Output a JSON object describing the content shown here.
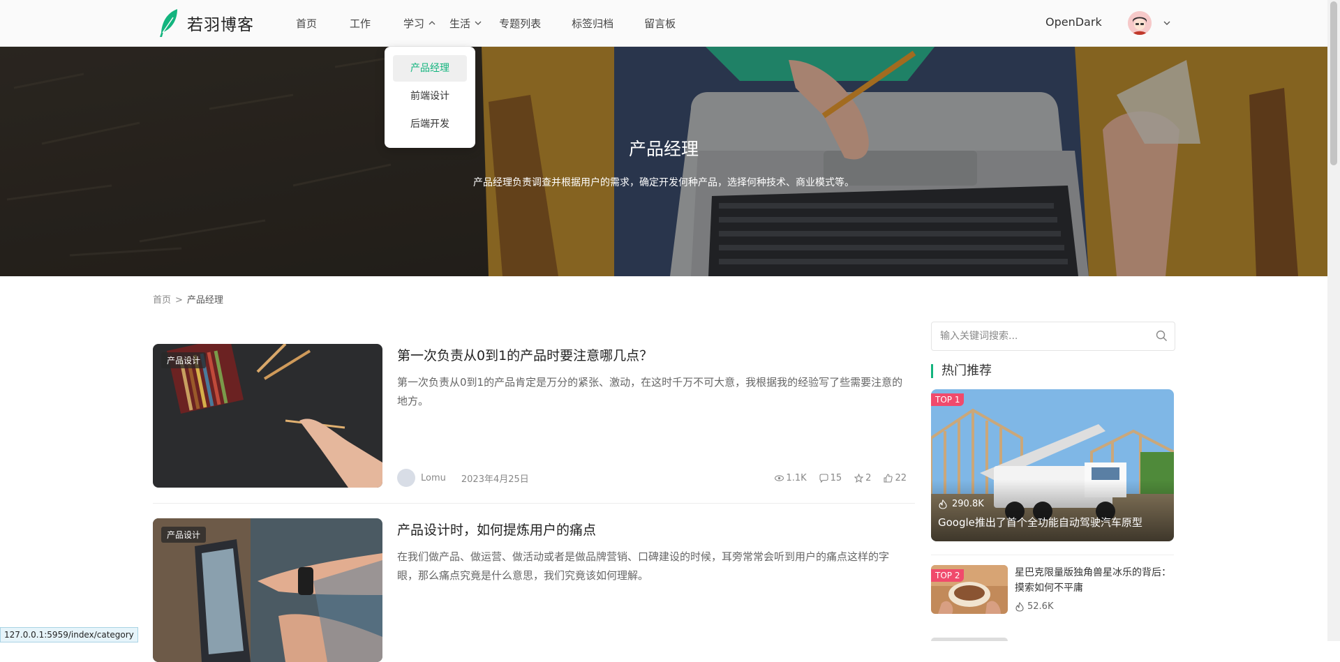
{
  "header": {
    "logo_text": "若羽博客",
    "nav": [
      {
        "label": "首页"
      },
      {
        "label": "工作"
      },
      {
        "label": "学习"
      },
      {
        "label": "生活"
      },
      {
        "label": "专题列表"
      },
      {
        "label": "标签归档"
      },
      {
        "label": "留言板"
      }
    ],
    "opendark_label": "OpenDark"
  },
  "dropdown": {
    "items": [
      {
        "label": "产品经理"
      },
      {
        "label": "前端设计"
      },
      {
        "label": "后端开发"
      }
    ]
  },
  "banner": {
    "title": "产品经理",
    "description": "产品经理负责调查并根据用户的需求，确定开发何种产品，选择何种技术、商业模式等。"
  },
  "breadcrumb": {
    "home": "首页",
    "separator": ">",
    "current": "产品经理"
  },
  "articles": [
    {
      "tag": "产品设计",
      "title": "第一次负责从0到1的产品时要注意哪几点？",
      "summary": "第一次负责从0到1的产品肯定是万分的紧张、激动，在这时千万不可大意，我根据我的经验写了些需要注意的地方。",
      "author": "Lomu",
      "date": "2023年4月25日",
      "views": "1.1K",
      "comments": "15",
      "favorites": "2",
      "likes": "22"
    },
    {
      "tag": "产品设计",
      "title": "产品设计时，如何提炼用户的痛点",
      "summary": "在我们做产品、做运营、做活动或者是做品牌营销、口碑建设的时候，耳旁常常会听到用户的痛点这样的字眼，那么痛点究竟是什么意思，我们究竟该如何理解。"
    }
  ],
  "sidebar": {
    "search_placeholder": "输入关键词搜索...",
    "hot_title": "热门推荐",
    "hot": [
      {
        "badge": "TOP 1",
        "views": "290.8K",
        "title": "Google推出了首个全功能自动驾驶汽车原型"
      },
      {
        "badge": "TOP 2",
        "views": "52.6K",
        "title": "星巴克限量版独角兽星冰乐的背后：摸索如何不平庸"
      }
    ]
  },
  "status_url": "127.0.0.1:5959/index/category",
  "colors": {
    "accent": "#13b47e",
    "badge": "#f04a6c"
  }
}
